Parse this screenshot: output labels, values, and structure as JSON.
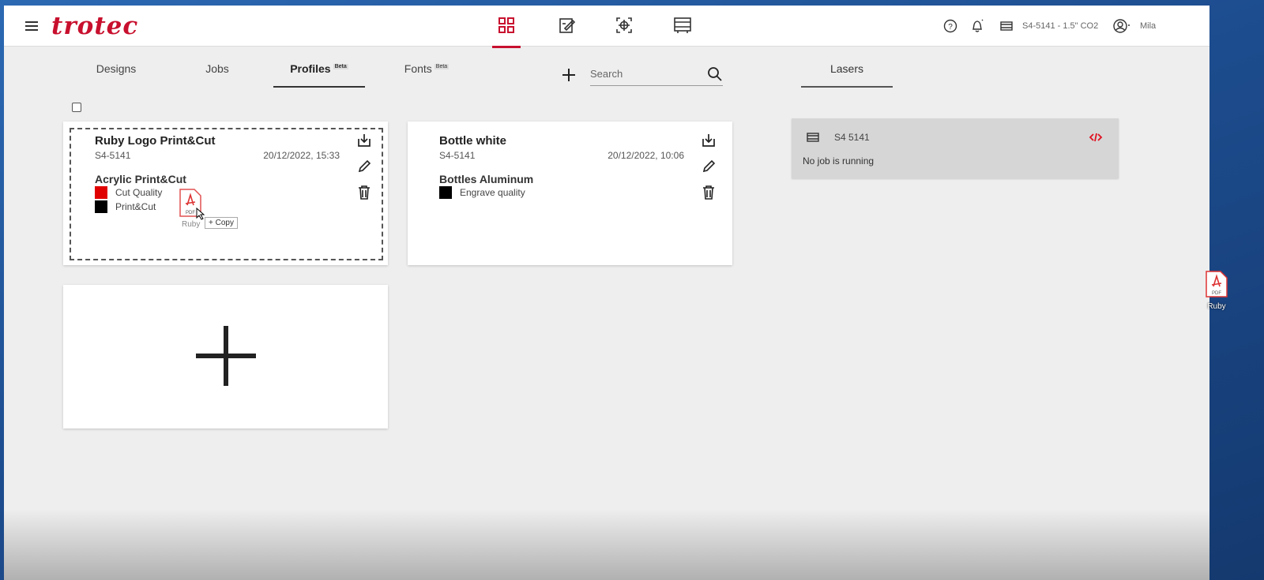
{
  "app": {
    "logo": "trotec"
  },
  "topbar": {
    "status_text": "S4-5141 - 1.5\" CO2",
    "user_name": "Mila"
  },
  "tabs": [
    {
      "label": "Designs"
    },
    {
      "label": "Jobs"
    },
    {
      "label": "Profiles",
      "badge": "Beta"
    },
    {
      "label": "Fonts",
      "badge": "Beta"
    }
  ],
  "search": {
    "placeholder": "Search"
  },
  "cards": [
    {
      "title": "Ruby Logo Print&Cut",
      "device": "S4-5141",
      "date": "20/12/2022, 15:33",
      "material": "Acrylic Print&Cut",
      "processes": [
        {
          "label": "Cut Quality",
          "color": "#e00000"
        },
        {
          "label": "Print&Cut",
          "color": "#000000"
        }
      ]
    },
    {
      "title": "Bottle white",
      "device": "S4-5141",
      "date": "20/12/2022, 10:06",
      "material": "Bottles Aluminum",
      "processes": [
        {
          "label": "Engrave quality",
          "color": "#000000"
        }
      ]
    }
  ],
  "drag": {
    "file_label": "Ruby",
    "copy_label": "+ Copy"
  },
  "lasers": {
    "tab_label": "Lasers",
    "device_name": "S4 5141",
    "status": "No job is running"
  },
  "desktop": {
    "icon_label": "Ruby"
  },
  "colors": {
    "brand": "#c8102e",
    "panel": "#d6d6d6"
  }
}
